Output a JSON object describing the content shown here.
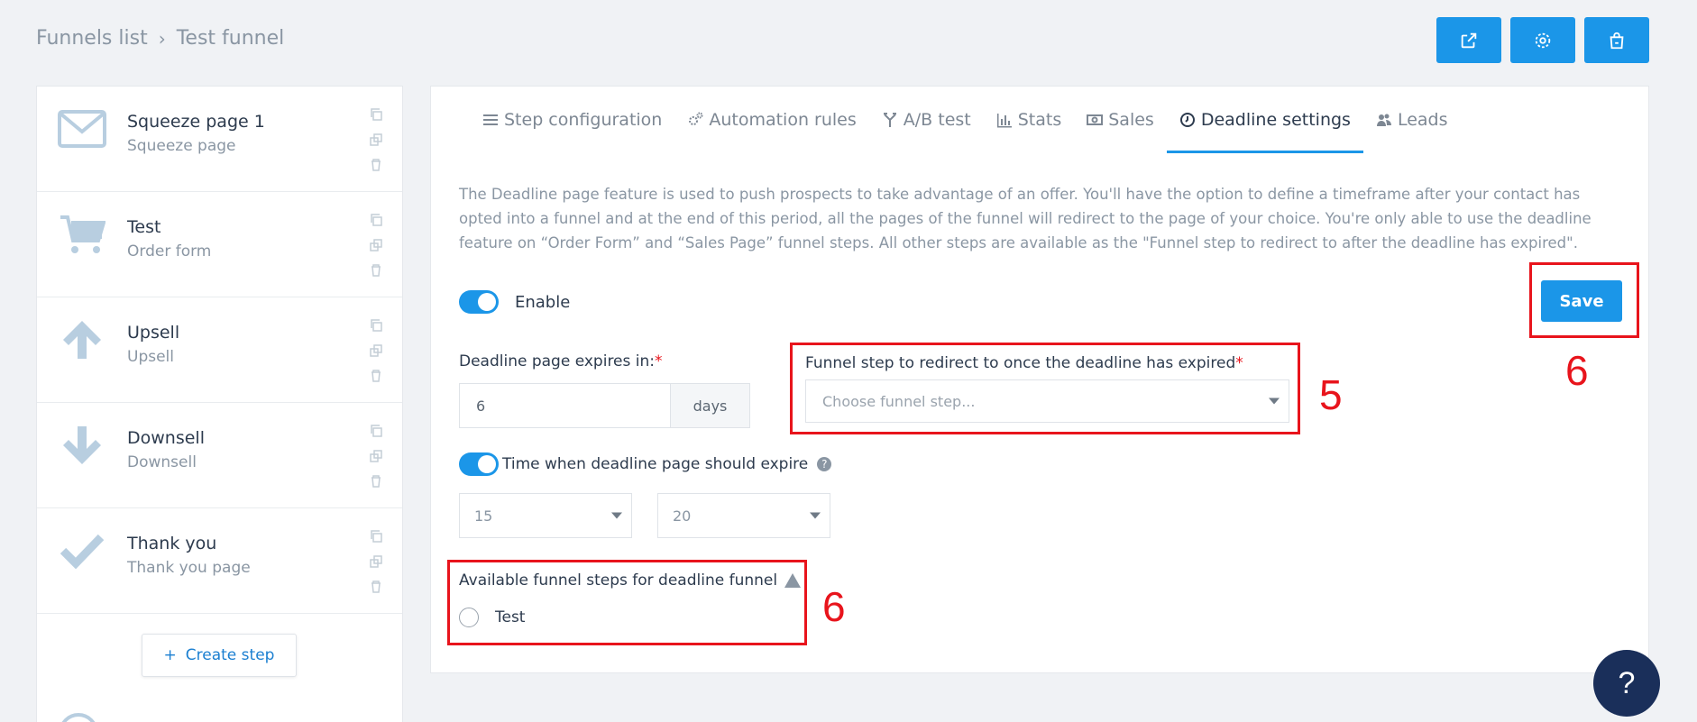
{
  "breadcrumb": {
    "parent": "Funnels list",
    "current": "Test funnel"
  },
  "top_actions": [
    {
      "icon": "external-link-icon"
    },
    {
      "icon": "gear-icon"
    },
    {
      "icon": "shopping-bag-icon"
    }
  ],
  "sidebar": {
    "steps": [
      {
        "title": "Squeeze page 1",
        "subtitle": "Squeeze page",
        "icon": "envelope-icon"
      },
      {
        "title": "Test",
        "subtitle": "Order form",
        "icon": "cart-icon"
      },
      {
        "title": "Upsell",
        "subtitle": "Upsell",
        "icon": "arrow-up-icon"
      },
      {
        "title": "Downsell",
        "subtitle": "Downsell",
        "icon": "arrow-down-icon"
      },
      {
        "title": "Thank you",
        "subtitle": "Thank you page",
        "icon": "check-icon"
      }
    ],
    "create_step_label": "Create step",
    "create_step_icon": "+"
  },
  "tabs": [
    {
      "label": "Step configuration",
      "icon": "list-icon"
    },
    {
      "label": "Automation rules",
      "icon": "cogs-icon"
    },
    {
      "label": "A/B test",
      "icon": "split-icon"
    },
    {
      "label": "Stats",
      "icon": "bar-chart-icon"
    },
    {
      "label": "Sales",
      "icon": "money-icon"
    },
    {
      "label": "Deadline settings",
      "icon": "clock-icon",
      "active": true
    },
    {
      "label": "Leads",
      "icon": "users-icon"
    }
  ],
  "deadline": {
    "description": "The Deadline page feature is used to push prospects to take advantage of an offer. You'll have the option to define a timeframe after your contact has opted into a funnel and at the end of this period, all the pages of the funnel will redirect to the page of your choice. You're only able to use the deadline feature on “Order Form” and “Sales Page” funnel steps. All other steps are available as the \"Funnel step to redirect to after the deadline has expired\".",
    "enable_label": "Enable",
    "save_label": "Save",
    "expires_label": "Deadline page expires in:",
    "expires_value": "6",
    "expires_unit": "days",
    "redirect_label": "Funnel step to redirect to once the deadline has expired",
    "redirect_placeholder": "Choose funnel step...",
    "time_label": "Time when deadline page should expire",
    "hour_value": "15",
    "minute_value": "20",
    "available_label": "Available funnel steps for deadline funnel",
    "available_option": "Test",
    "required_mark": "*"
  },
  "annotations": {
    "redirect": "5",
    "save": "6",
    "available": "6"
  },
  "help_fab": "?",
  "colors": {
    "accent": "#1b96e8",
    "annotation": "#e8141c",
    "fab": "#1a2f5a"
  }
}
